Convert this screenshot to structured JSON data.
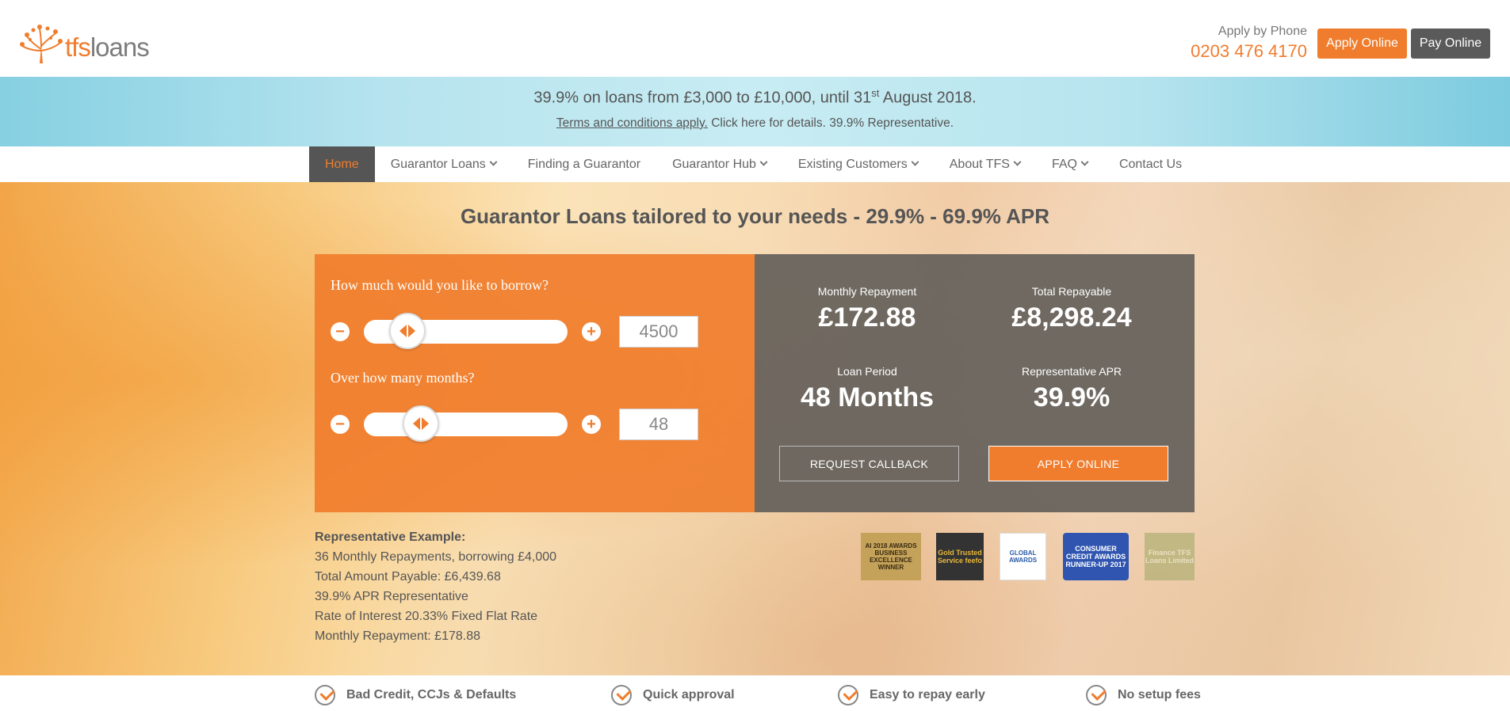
{
  "brand": {
    "logo_tfs": "tfs",
    "logo_loans": "loans",
    "accent_color": "#f07d2d",
    "dark_color": "#555555"
  },
  "header": {
    "phone_label": "Apply by Phone",
    "phone_number": "0203 476 4170",
    "apply_online": "Apply Online",
    "pay_online": "Pay Online"
  },
  "promo": {
    "line1_text": "39.9% on loans from £3,000 to £10,000, until 31",
    "line1_sup": "st",
    "line1_tail": " August 2018.",
    "terms_link": "Terms and conditions apply.",
    "line2_tail": " Click here for details. 39.9% Representative."
  },
  "nav": {
    "items": [
      {
        "label": "Home",
        "active": true,
        "dropdown": false
      },
      {
        "label": "Guarantor Loans",
        "active": false,
        "dropdown": true
      },
      {
        "label": "Finding a Guarantor",
        "active": false,
        "dropdown": false
      },
      {
        "label": "Guarantor Hub",
        "active": false,
        "dropdown": true
      },
      {
        "label": "Existing Customers",
        "active": false,
        "dropdown": true
      },
      {
        "label": "About TFS",
        "active": false,
        "dropdown": true
      },
      {
        "label": "FAQ",
        "active": false,
        "dropdown": true
      },
      {
        "label": "Contact Us",
        "active": false,
        "dropdown": false
      }
    ]
  },
  "hero": {
    "title": "Guarantor Loans tailored to your needs - 29.9% - 69.9% APR"
  },
  "calculator": {
    "borrow_question": "How much would you like to borrow?",
    "borrow_value": "4500",
    "borrow_slider_fraction": 0.15,
    "months_question": "Over how many months?",
    "months_value": "48",
    "months_slider_fraction": 0.23,
    "minus_symbol": "−",
    "plus_symbol": "+"
  },
  "results": {
    "monthly_label": "Monthly Repayment",
    "monthly_value": "£172.88",
    "total_label": "Total Repayable",
    "total_value": "£8,298.24",
    "period_label": "Loan Period",
    "period_value": "48 Months",
    "apr_label": "Representative APR",
    "apr_value": "39.9%",
    "callback_button": "REQUEST CALLBACK",
    "apply_button": "APPLY ONLINE"
  },
  "representative": {
    "title": "Representative Example:",
    "lines": [
      "36 Monthly Repayments, borrowing £4,000",
      "Total Amount Payable: £6,439.68",
      "39.9% APR Representative",
      "Rate of Interest 20.33% Fixed Flat Rate",
      "Monthly Repayment: £178.88"
    ]
  },
  "awards": {
    "ai": "AI 2018 AWARDS BUSINESS EXCELLENCE WINNER",
    "feefo": "Gold Trusted Service feefo",
    "global": "GLOBAL AWARDS",
    "cca": "CONSUMER CREDIT AWARDS RUNNER-UP 2017",
    "finance": "Finance TFS Loans Limited"
  },
  "features": [
    "Bad Credit, CCJs & Defaults",
    "Quick approval",
    "Easy to repay early",
    "No setup fees"
  ]
}
